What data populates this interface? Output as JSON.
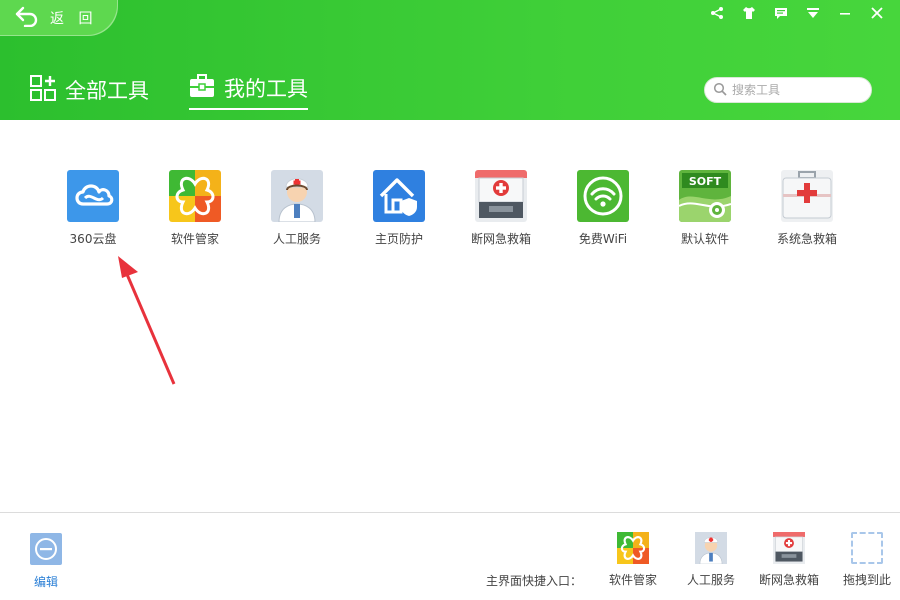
{
  "header": {
    "back_label": "返 回",
    "tabs": [
      {
        "label": "全部工具",
        "icon": "grid-icon"
      },
      {
        "label": "我的工具",
        "icon": "toolbox-icon",
        "active": true
      }
    ],
    "search": {
      "placeholder": "搜索工具"
    },
    "window_controls": [
      "share-icon",
      "skin-icon",
      "message-icon",
      "menu-icon",
      "minimize-icon",
      "close-icon"
    ]
  },
  "tools": [
    {
      "label": "360云盘",
      "icon": "cloud-icon"
    },
    {
      "label": "软件管家",
      "icon": "software-manager-icon"
    },
    {
      "label": "人工服务",
      "icon": "doctor-icon"
    },
    {
      "label": "主页防护",
      "icon": "home-shield-icon"
    },
    {
      "label": "断网急救箱",
      "icon": "network-firstaid-icon"
    },
    {
      "label": "免费WiFi",
      "icon": "wifi-icon"
    },
    {
      "label": "默认软件",
      "icon": "soft-gear-icon"
    },
    {
      "label": "系统急救箱",
      "icon": "system-firstaid-icon"
    }
  ],
  "footer": {
    "edit_label": "编辑",
    "shortcut_title": "主界面快捷入口：",
    "shortcuts": [
      {
        "label": "软件管家",
        "icon": "software-manager-icon"
      },
      {
        "label": "人工服务",
        "icon": "doctor-icon"
      },
      {
        "label": "断网急救箱",
        "icon": "network-firstaid-icon"
      },
      {
        "label": "拖拽到此",
        "icon": "drop-slot"
      }
    ]
  },
  "colors": {
    "header_green": "#3fcf38",
    "accent_blue": "#2a7fd6",
    "arrow_red": "#e8323c"
  }
}
